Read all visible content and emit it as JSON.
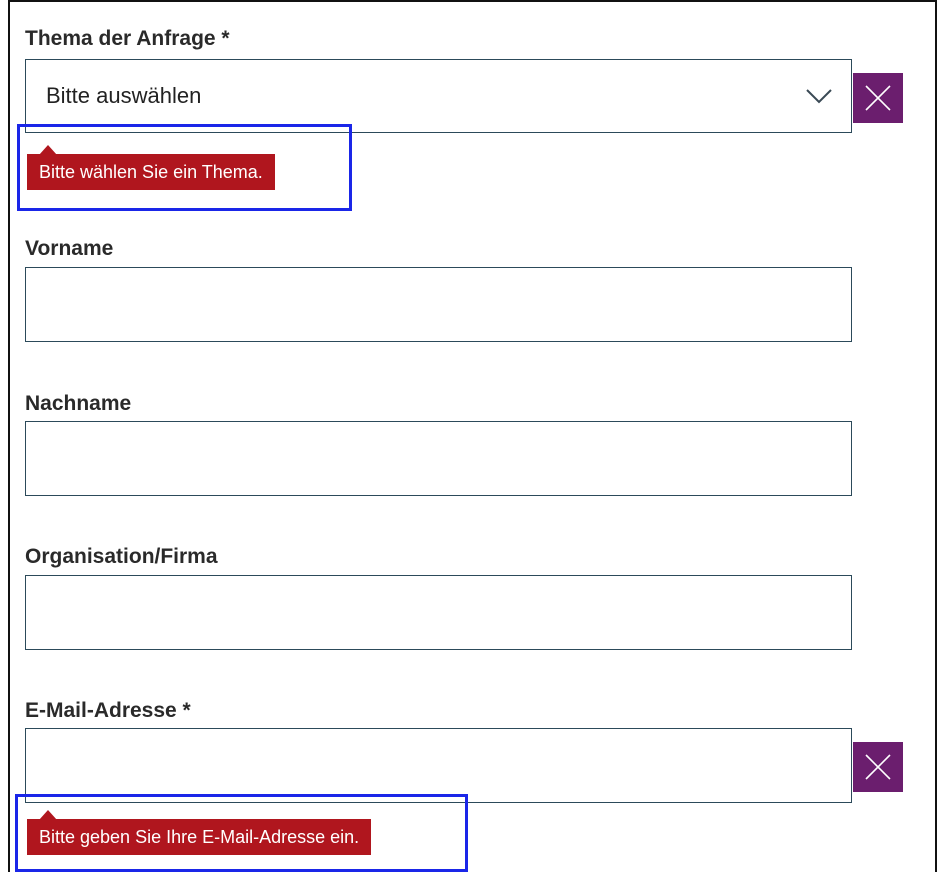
{
  "form": {
    "topic": {
      "label": "Thema der Anfrage *",
      "selected": "Bitte auswählen",
      "error": "Bitte wählen Sie ein Thema."
    },
    "first_name": {
      "label": "Vorname",
      "value": ""
    },
    "last_name": {
      "label": "Nachname",
      "value": ""
    },
    "organisation": {
      "label": "Organisation/Firma",
      "value": ""
    },
    "email": {
      "label": "E-Mail-Adresse *",
      "value": "",
      "error": "Bitte geben Sie Ihre E-Mail-Adresse ein."
    }
  },
  "icons": {
    "clear": "close-icon",
    "dropdown": "chevron-down-icon"
  },
  "colors": {
    "error_bg": "#b0161e",
    "clear_button_bg": "#6b1e6e",
    "field_border": "#2c4a5a",
    "highlight_border": "#1a26e8"
  }
}
